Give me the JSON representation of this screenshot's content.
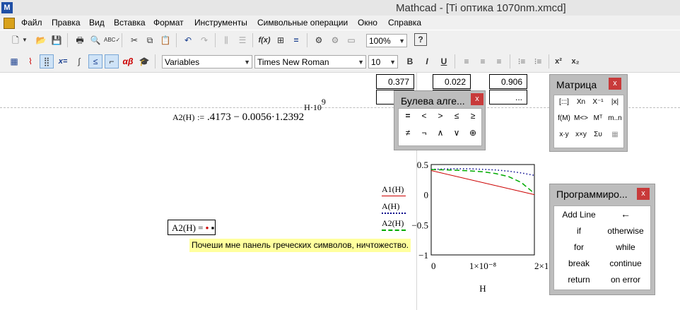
{
  "app": {
    "icon_letter": "M",
    "title": "Mathcad - [Ti оптика 1070nm.xmcd]"
  },
  "menu": [
    "Файл",
    "Правка",
    "Вид",
    "Вставка",
    "Формат",
    "Инструменты",
    "Символьные операции",
    "Окно",
    "Справка"
  ],
  "toolbar": {
    "icons": [
      "new-icon",
      "open-icon",
      "save-icon",
      "print-icon",
      "print-preview-icon",
      "spell-check-icon",
      "cut-icon",
      "copy-icon",
      "paste-icon",
      "undo-icon",
      "redo-icon",
      "align-vertical-icon",
      "align-horizontal-icon",
      "insert-function-icon",
      "insert-unit-icon",
      "resource-center-icon",
      "equals-icon",
      "calculate-icon",
      "calculate-all-icon",
      "component-icon",
      "help-icon"
    ],
    "zoom": "100%",
    "help_label": "?"
  },
  "formatting": {
    "style": "Variables",
    "font": "Times New Roman",
    "size": "10",
    "bold": "B",
    "italic": "I",
    "underline": "U",
    "superscript": "x²",
    "subscript": "x₂"
  },
  "math_toolbar": {
    "evaluation": "x=",
    "greek": "αβ"
  },
  "table": {
    "row1": [
      "0.377",
      "0.022",
      "0.906"
    ],
    "row2": [
      "...",
      "..."
    ]
  },
  "formula": {
    "lhs": "A2(H)",
    "def": ":=",
    "rhs_a": ".4173 − 0.0056·1.2392",
    "exp_base": "H·10",
    "exp_power": "9"
  },
  "eval": {
    "expr": "A2(H) =",
    "placeholder": "▪"
  },
  "tooltip": "Почеши мне панель греческих символов, ничтожество.",
  "boolean_panel": {
    "title": "Булева алге...",
    "close": "x",
    "buttons": [
      "=",
      "<",
      ">",
      "≤",
      "≥",
      "≠",
      "¬",
      "∧",
      "∨",
      "⊕"
    ]
  },
  "matrix_panel": {
    "title": "Матрица",
    "close": "x",
    "buttons": [
      "[:::]",
      "Xn",
      "X⁻¹",
      "|x|",
      "f(M)",
      "M<>",
      "Mᵀ",
      "m..n",
      "x·y",
      "x×y",
      "Συ",
      "▦"
    ]
  },
  "programming_panel": {
    "title": "Программиро...",
    "close": "x",
    "buttons": [
      "Add Line",
      "←",
      "if",
      "otherwise",
      "for",
      "while",
      "break",
      "continue",
      "return",
      "on error"
    ]
  },
  "chart_data": {
    "type": "line",
    "xlabel": "H",
    "x_ticks": [
      "0",
      "1×10⁻⁸",
      "2×10⁻⁸"
    ],
    "y_ticks": [
      "0.5",
      "0",
      "−0.5",
      "−1"
    ],
    "xlim": [
      0,
      2e-08
    ],
    "ylim": [
      -1,
      0.5
    ],
    "series": [
      {
        "name": "A1(H)",
        "color": "#cc0000",
        "style": "solid",
        "x": [
          0,
          2e-08
        ],
        "y": [
          0.4,
          0.0
        ]
      },
      {
        "name": "A(H)",
        "color": "#00008b",
        "style": "dotted",
        "x": [
          0,
          2.5e-09,
          5e-09,
          7.5e-09,
          1e-08,
          1.25e-08,
          1.5e-08,
          1.75e-08,
          2e-08
        ],
        "y": [
          0.42,
          0.425,
          0.43,
          0.43,
          0.42,
          0.41,
          0.39,
          0.36,
          0.32
        ]
      },
      {
        "name": "A2(H)",
        "color": "#00aa00",
        "style": "dashed",
        "x": [
          0,
          2.5e-09,
          5e-09,
          7.5e-09,
          1e-08,
          1.25e-08,
          1.5e-08,
          1.75e-08,
          2e-08
        ],
        "y": [
          0.417,
          0.412,
          0.405,
          0.395,
          0.38,
          0.35,
          0.3,
          0.2,
          0.02
        ]
      }
    ]
  }
}
